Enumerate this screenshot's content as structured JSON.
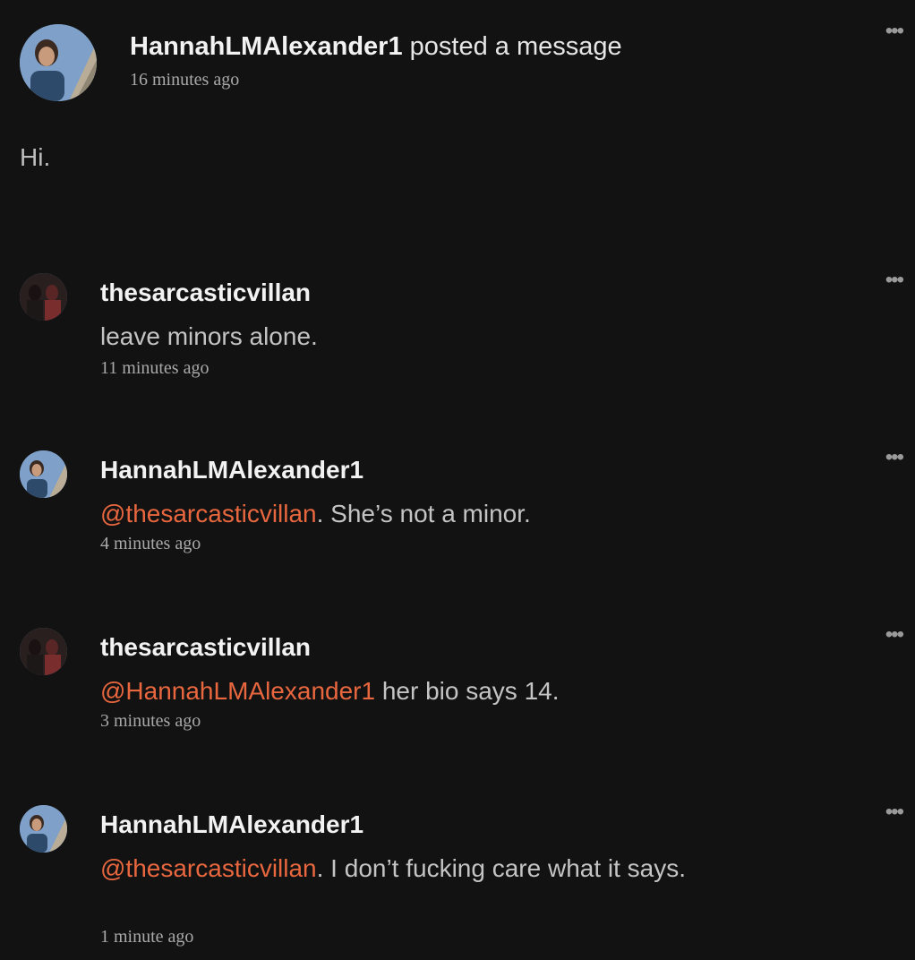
{
  "post": {
    "author": "HannahLMAlexander1",
    "action": "posted a message",
    "time": "16 minutes ago",
    "body": "Hi.",
    "more_icon": "more-horizontal-icon"
  },
  "comments": [
    {
      "author": "thesarcasticvillan",
      "mention": "",
      "text": "leave minors alone.",
      "time": "11 minutes ago"
    },
    {
      "author": "HannahLMAlexander1",
      "mention": "@thesarcasticvillan",
      "text": ". She’s not a minor.",
      "time": "4 minutes ago"
    },
    {
      "author": "thesarcasticvillan",
      "mention": "@HannahLMAlexander1",
      "text": " her bio says 14.",
      "time": "3 minutes ago"
    },
    {
      "author": "HannahLMAlexander1",
      "mention": "@thesarcasticvillan",
      "text": ". I don’t fucking care what it says.",
      "time": "1 minute ago"
    }
  ],
  "colors": {
    "background": "#121212",
    "mention": "#e8673f",
    "muted": "#a9a9a9"
  }
}
